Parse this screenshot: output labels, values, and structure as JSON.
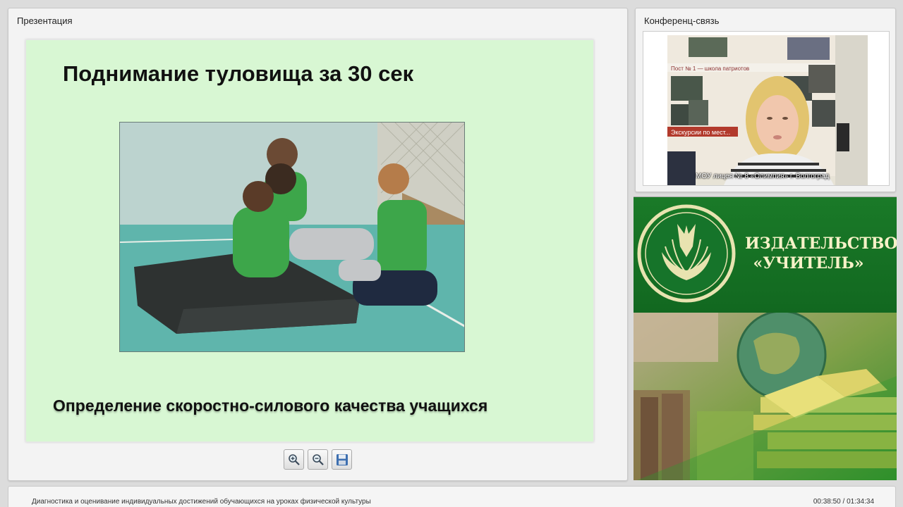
{
  "presentation": {
    "title": "Презентация",
    "slide": {
      "heading": "Поднимание туловища за 30 сек",
      "caption": "Определение скоростно-силового качества учащихся",
      "photo_description_icon": "photo-image"
    },
    "toolbar": {
      "zoom_in_icon": "zoom-in-icon",
      "zoom_out_icon": "zoom-out-icon",
      "save_icon": "save-icon"
    }
  },
  "conference": {
    "title": "Конференц-связь",
    "video_caption": "МОУ лицея № 8 «Олимпия» г. Волгоград",
    "poster_text_1": "Пост № 1 — школа патриотов",
    "poster_text_2": "Экскурсии по мест..."
  },
  "publisher": {
    "name_line1": "ИЗДАТЕЛЬСТВО",
    "name_line2": "«УЧИТЕЛЬ»",
    "brand_color": "#156f24"
  },
  "footer": {
    "lecture_title": "Диагностика и оценивание индивидуальных достижений обучающихся на уроках физической культуры",
    "time": "00:38:50 / 01:34:34"
  }
}
